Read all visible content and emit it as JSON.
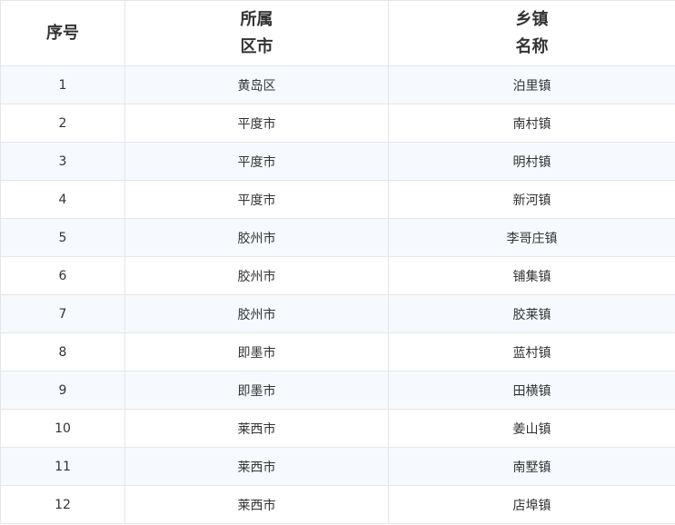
{
  "header": {
    "col1": [
      "序号"
    ],
    "col2": [
      "所属",
      "区市"
    ],
    "col3": [
      "乡镇",
      "名称"
    ]
  },
  "rows": [
    {
      "no": "1",
      "district": "黄岛区",
      "town": "泊里镇"
    },
    {
      "no": "2",
      "district": "平度市",
      "town": "南村镇"
    },
    {
      "no": "3",
      "district": "平度市",
      "town": "明村镇"
    },
    {
      "no": "4",
      "district": "平度市",
      "town": "新河镇"
    },
    {
      "no": "5",
      "district": "胶州市",
      "town": "李哥庄镇"
    },
    {
      "no": "6",
      "district": "胶州市",
      "town": "铺集镇"
    },
    {
      "no": "7",
      "district": "胶州市",
      "town": "胶莱镇"
    },
    {
      "no": "8",
      "district": "即墨市",
      "town": "蓝村镇"
    },
    {
      "no": "9",
      "district": "即墨市",
      "town": "田横镇"
    },
    {
      "no": "10",
      "district": "莱西市",
      "town": "姜山镇"
    },
    {
      "no": "11",
      "district": "莱西市",
      "town": "南墅镇"
    },
    {
      "no": "12",
      "district": "莱西市",
      "town": "店埠镇"
    }
  ],
  "colors": {
    "border": "#e3e6ea",
    "stripe": "#f6faff",
    "text": "#333333"
  }
}
